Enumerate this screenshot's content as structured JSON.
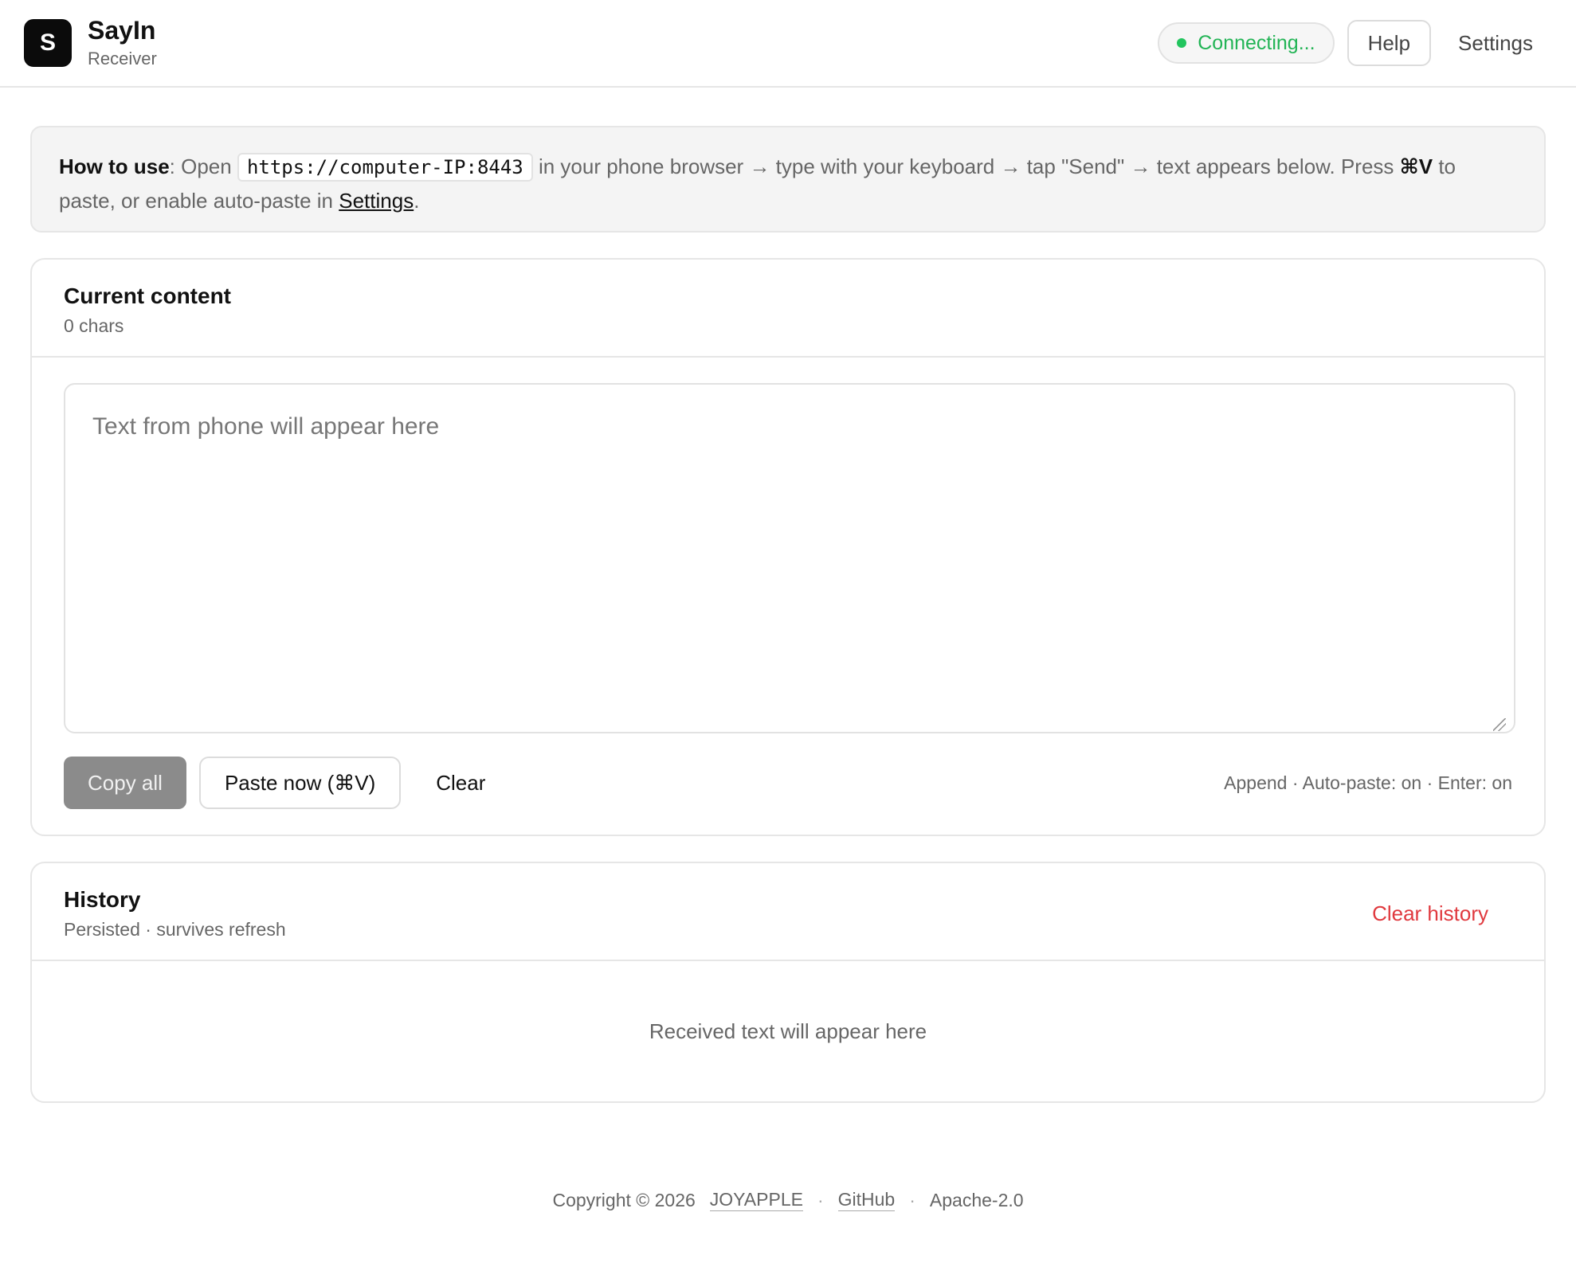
{
  "app": {
    "logo_letter": "S",
    "title": "SayIn",
    "subtitle": "Receiver"
  },
  "header": {
    "status_label": "Connecting...",
    "status_color": "#22c55e",
    "help_label": "Help",
    "settings_label": "Settings"
  },
  "howto": {
    "label": "How to use",
    "intro": ": Open ",
    "url": "https://computer-IP:8443",
    "middle": " in your phone browser → type with your keyboard → tap \"Send\" → text appears below. Press ",
    "shortcut": "⌘V",
    "tail": " to paste, or enable auto-paste in ",
    "settings_link": "Settings",
    "end": "."
  },
  "current": {
    "title": "Current content",
    "count": "0 chars",
    "placeholder": "Text from phone will appear here",
    "value": "",
    "copy_label": "Copy all",
    "paste_label": "Paste now (⌘V)",
    "clear_label": "Clear",
    "mode_text": "Append · Auto-paste: on · Enter: on"
  },
  "history": {
    "title": "History",
    "subtitle": "Persisted · survives refresh",
    "clear_label": "Clear history",
    "empty_text": "Received text will appear here"
  },
  "footer": {
    "copyright": "Copyright © 2026",
    "owner": "JOYAPPLE",
    "github": "GitHub",
    "separator": "·",
    "license": "Apache-2.0"
  }
}
